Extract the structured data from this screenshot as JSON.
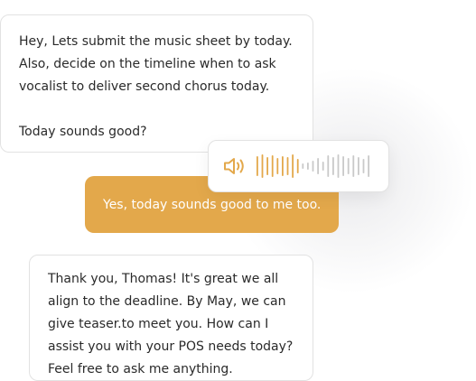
{
  "chat": {
    "messages": [
      {
        "sender": "them",
        "text": "Hey, Lets submit the music sheet by today.\nAlso, decide on the timeline when to ask\nvocalist to deliver second chorus today.\n\nToday sounds good?"
      },
      {
        "sender": "me",
        "text": "Yes, today sounds good to me too."
      },
      {
        "sender": "them",
        "text": "Thank you, Thomas! It's great  we all\nalign to the deadline. By May, we can\ngive teaser.to meet you. How can I\nassist you with your POS needs today?\nFeel free to ask me anything."
      }
    ],
    "audio": {
      "icon": "speaker-icon",
      "played_color": "#e3a84b",
      "unplayed_color": "#c9c9c9"
    }
  },
  "colors": {
    "accent": "#e3a84b",
    "border": "#e2e2e2",
    "text": "#2a2a2a"
  }
}
